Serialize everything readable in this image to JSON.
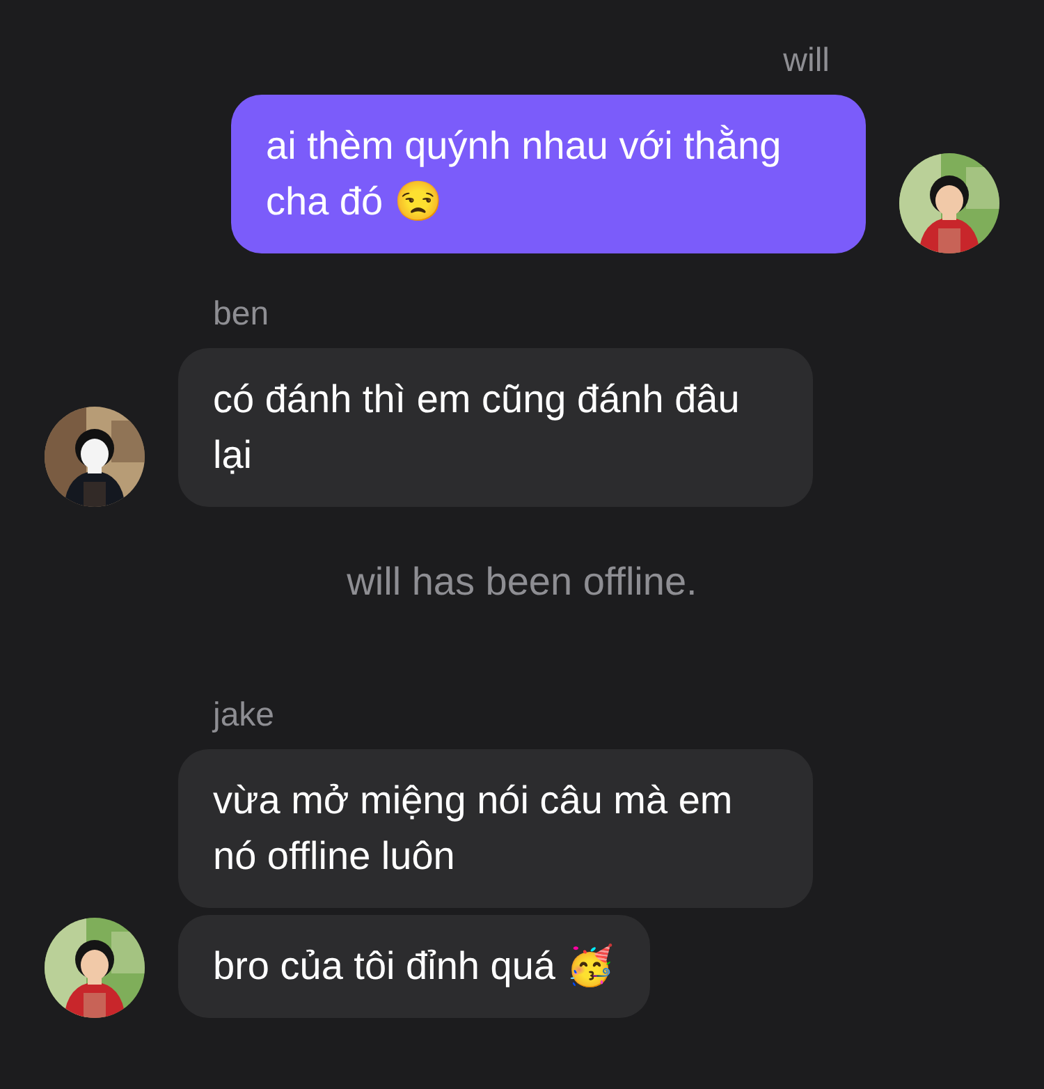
{
  "messages": [
    {
      "kind": "outgoing",
      "sender": "will",
      "bubbles": [
        "ai thèm quýnh nhau với thằng cha đó 😒"
      ]
    },
    {
      "kind": "incoming",
      "sender": "ben",
      "bubbles": [
        "có đánh thì em cũng đánh đâu lại"
      ]
    },
    {
      "kind": "system",
      "text": "will has been offline."
    },
    {
      "kind": "incoming",
      "sender": "jake",
      "bubbles": [
        "vừa mở miệng nói câu mà em nó offline luôn",
        "bro của tôi đỉnh quá 🥳"
      ]
    }
  ]
}
